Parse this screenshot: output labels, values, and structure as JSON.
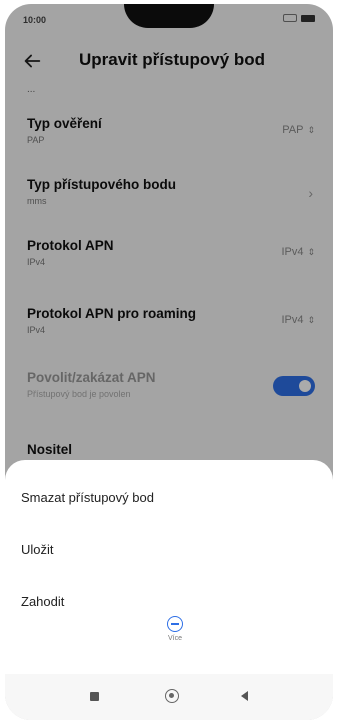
{
  "status_bar": {
    "time": "10:00"
  },
  "header": {
    "title": "Upravit přístupový bod"
  },
  "truncated_above": "...",
  "settings": [
    {
      "title": "Typ ověření",
      "subtitle": "PAP",
      "value": "PAP",
      "control": "spinner"
    },
    {
      "title": "Typ přístupového bodu",
      "subtitle": "mms",
      "control": "chevron"
    },
    {
      "title": "Protokol APN",
      "subtitle": "IPv4",
      "value": "IPv4",
      "control": "spinner"
    },
    {
      "title": "Protokol APN pro roaming",
      "subtitle": "IPv4",
      "value": "IPv4",
      "control": "spinner"
    },
    {
      "title": "Povolit/zakázat APN",
      "subtitle": "Přístupový bod je povolen",
      "control": "toggle",
      "enabled": true,
      "disabled_style": true
    }
  ],
  "partial_next_item": "Nositel",
  "bottom_sheet": {
    "items": [
      "Smazat přístupový bod",
      "Uložit",
      "Zahodit"
    ],
    "more_label": "Více"
  },
  "icons": {
    "back": "arrow-left-icon",
    "spinner": "updown-arrows-icon",
    "chevron": "chevron-right-icon",
    "more": "minus-circle-icon",
    "nav_recents": "square-icon",
    "nav_home": "circle-icon",
    "nav_back": "triangle-back-icon"
  },
  "colors": {
    "accent": "#2e6fe6",
    "scrim": "rgba(0,0,0,0.33)"
  }
}
